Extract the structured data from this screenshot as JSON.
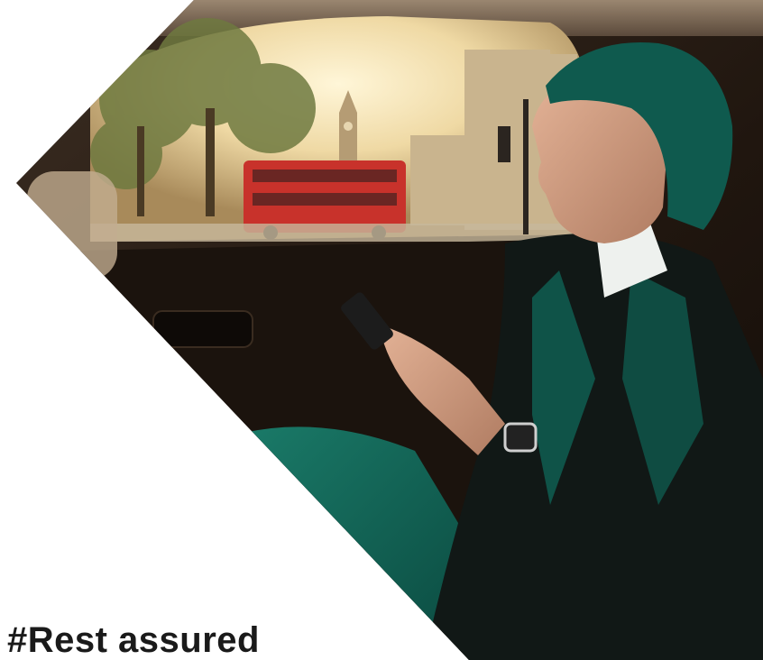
{
  "ad": {
    "headline": "#Rest assured"
  },
  "colors": {
    "background": "#ffffff",
    "headline_text": "#1a1a1a",
    "headscarf_teal": "#0f5a4e",
    "bus_red": "#c8322b",
    "sunlight": "#f8e7b8",
    "car_interior": "#2a1e17"
  },
  "scene": {
    "icons": [
      "smartphone-icon",
      "wristwatch-icon"
    ]
  }
}
